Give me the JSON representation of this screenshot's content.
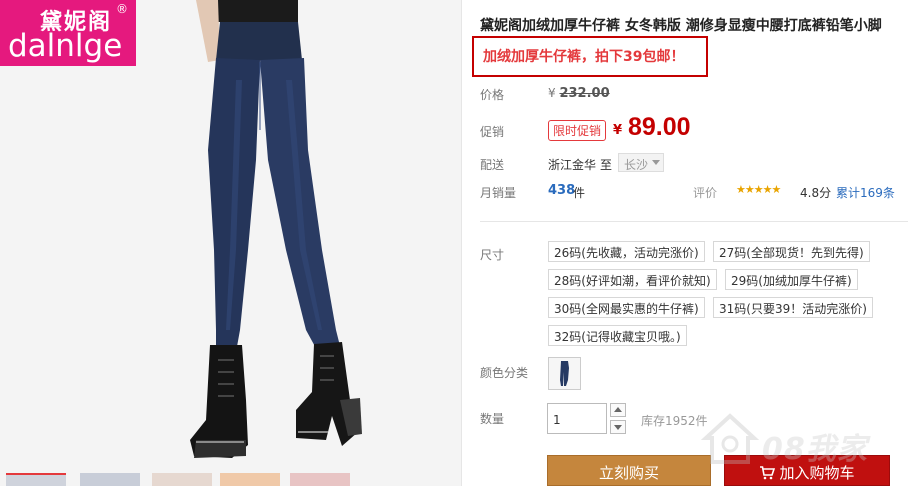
{
  "brand": {
    "name_cn": "黛妮阁",
    "name_en": "dalnlge",
    "registered_mark": "®"
  },
  "product": {
    "title": "黛妮阁加绒加厚牛仔裤 女冬韩版 潮修身显瘦中腰打底裤铅笔小脚",
    "promo_note": "加绒加厚牛仔裤，拍下39包邮！"
  },
  "labels": {
    "price": "价格",
    "promo": "促销",
    "shipping": "配送",
    "monthly_sales": "月销量",
    "rating": "评价",
    "size": "尺寸",
    "color": "颜色分类",
    "quantity": "数量"
  },
  "price": {
    "currency": "¥",
    "original": "232.00",
    "promo_tag": "限时促销",
    "current": "89.00"
  },
  "shipping": {
    "from": "浙江金华",
    "to_word": "至",
    "destination": "长沙"
  },
  "sales": {
    "count": "438",
    "unit": "件"
  },
  "rating": {
    "stars": "★★★★★",
    "score": "4.8分",
    "total": "累计169条"
  },
  "sizes": [
    "26码(先收藏，活动完涨价)",
    "27码(全部现货！先到先得)",
    "28码(好评如潮，看评价就知)",
    "29码(加绒加厚牛仔裤)",
    "30码(全网最实惠的牛仔裤)",
    "31码(只要39！活动完涨价)",
    "32码(记得收藏宝贝哦。)"
  ],
  "quantity": {
    "value": "1",
    "stock": "库存1952件"
  },
  "actions": {
    "buy_now": "立刻购买",
    "add_to_cart": "加入购物车"
  },
  "watermark": {
    "text": "08我家"
  },
  "colors": {
    "brand_pink": "#e5197e",
    "price_red": "#c40000",
    "buy_button": "#c5863d",
    "cart_button": "#c0100f",
    "link_blue": "#2a6bbd",
    "star_gold": "#e9a400"
  }
}
